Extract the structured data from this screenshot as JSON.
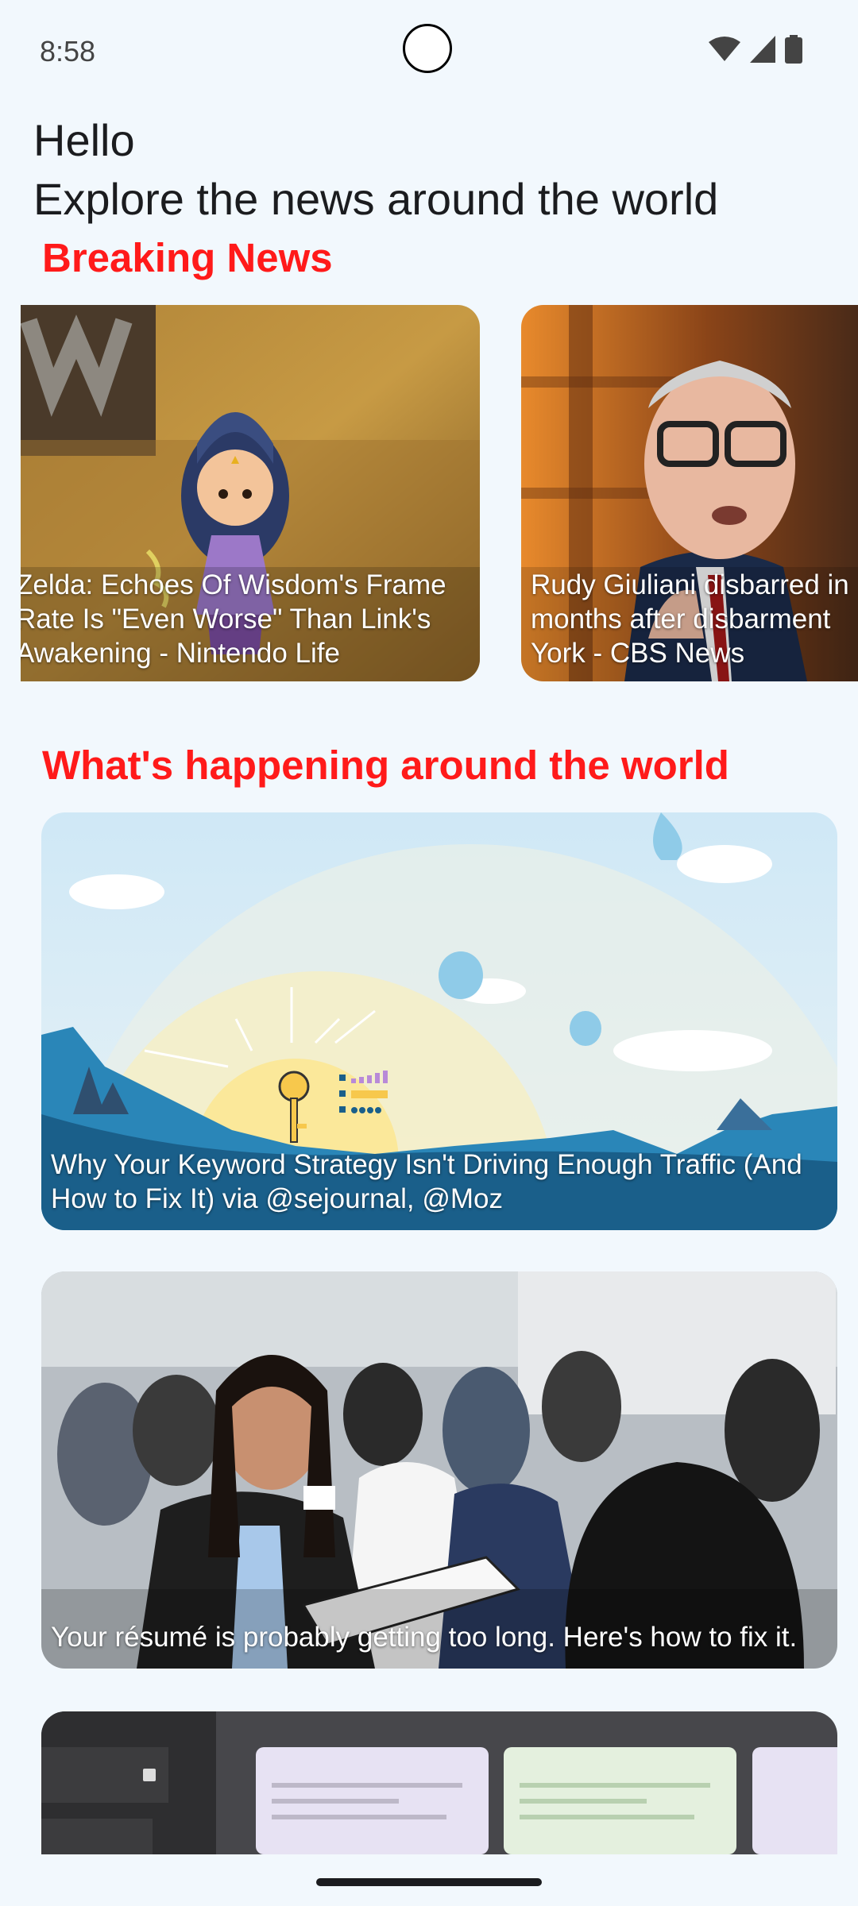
{
  "status_bar": {
    "time": "8:58"
  },
  "header": {
    "greeting": "Hello",
    "subtitle": "Explore the news around the world"
  },
  "breaking": {
    "title": "Breaking News",
    "cards": [
      {
        "caption": "Zelda: Echoes Of Wisdom's Frame Rate Is \"Even Worse\" Than Link's Awakening - Nintendo Life"
      },
      {
        "caption": "Rudy Giuliani disbarred in months after disbarment York - CBS News"
      }
    ]
  },
  "world": {
    "title": "What's happening around the world",
    "cards": [
      {
        "caption": "Why Your Keyword Strategy Isn't Driving Enough Traffic (And How to Fix It) via @sejournal, @Moz"
      },
      {
        "caption": "Your résumé is probably getting too long. Here's how to fix it."
      },
      {
        "caption": ""
      }
    ]
  },
  "colors": {
    "accent": "#ff1a1a",
    "background": "#f2f8fd"
  }
}
